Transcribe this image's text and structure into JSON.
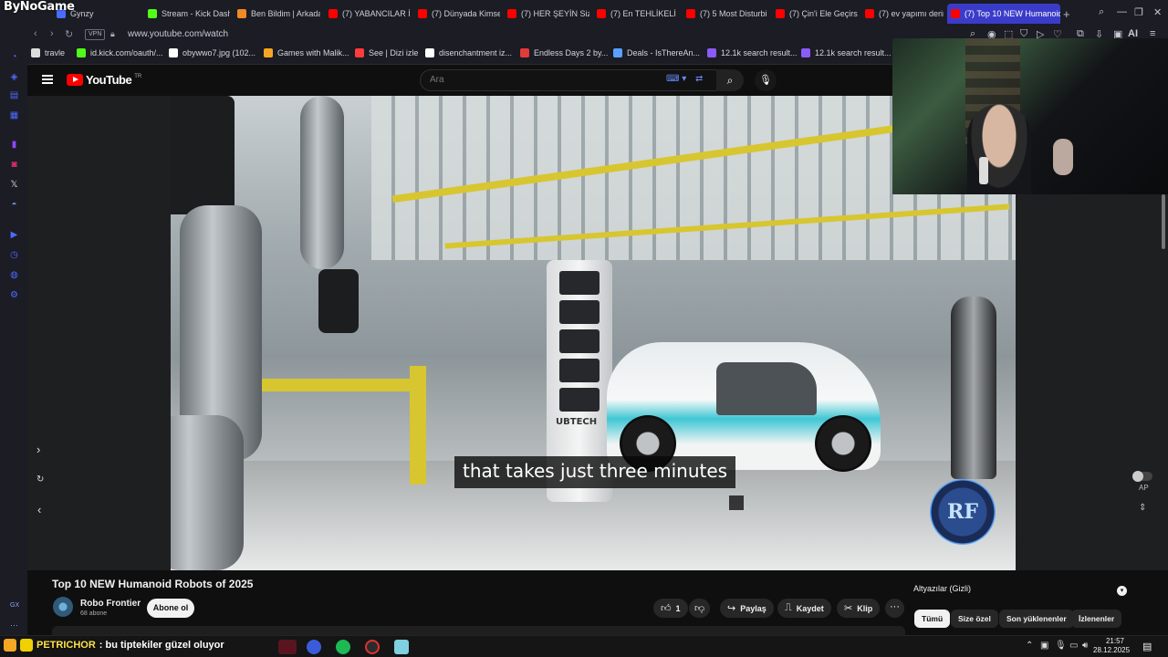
{
  "brand_logo": "ByNoGame",
  "tabs": [
    {
      "label": "Gynzy",
      "color": "#4a6cff"
    },
    {
      "label": "Stream - Kick Dash",
      "color": "#53fc18"
    },
    {
      "label": "Ben Bildim | Arkada",
      "color": "#f08a24"
    },
    {
      "label": "(7) YABANCILAR İ",
      "color": "#ff0000"
    },
    {
      "label": "(7) Dünyada Kimse",
      "color": "#ff0000"
    },
    {
      "label": "(7) HER ŞEYİN Siz",
      "color": "#ff0000"
    },
    {
      "label": "(7) En TEHLİKELİ",
      "color": "#ff0000"
    },
    {
      "label": "(7) 5 Most Disturbi",
      "color": "#ff0000"
    },
    {
      "label": "(7) Çin'i Ele Geçirs",
      "color": "#ff0000"
    },
    {
      "label": "(7) ev yapımı derin",
      "color": "#ff0000"
    },
    {
      "label": "(7) Top 10 NEW Humanoid",
      "color": "#ff0000",
      "active": true
    }
  ],
  "address": {
    "vpn": "VPN",
    "url": "www.youtube.com/watch",
    "ai_label": "AI"
  },
  "bookmarks": [
    {
      "label": "travle",
      "color": "#dddddd"
    },
    {
      "label": "id.kick.com/oauth/...",
      "color": "#53fc18"
    },
    {
      "label": "obywwo7.jpg (102...",
      "color": "#ffffff"
    },
    {
      "label": "Games with Malik...",
      "color": "#f5a623"
    },
    {
      "label": "See | Dizi izle",
      "color": "#ff3b3b"
    },
    {
      "label": "disenchantment iz...",
      "color": "#ffffff"
    },
    {
      "label": "Endless Days 2 by...",
      "color": "#e23b3b"
    },
    {
      "label": "Deals - IsThereAn...",
      "color": "#5aa0ff"
    },
    {
      "label": "12.1k search result...",
      "color": "#8a5cf5"
    },
    {
      "label": "12.1k search result...",
      "color": "#8a5cf5"
    }
  ],
  "sidebar": {
    "footer_label": "GX"
  },
  "youtube": {
    "logo_text": "YouTube",
    "logo_sup": "TR",
    "search_placeholder": "Ara"
  },
  "player": {
    "caption": "that takes just three minutes",
    "watermark": "RF",
    "brand_on_charger": "UBTECH",
    "ap_label": "AP"
  },
  "video": {
    "title": "Top 10 NEW Humanoid Robots of 2025",
    "channel": "Robo Frontier",
    "subscribers": "68 abone",
    "subscribe_label": "Abone ol",
    "like_count": "1",
    "share_label": "Paylaş",
    "save_label": "Kaydet",
    "clip_label": "Klip"
  },
  "right_panel": {
    "subtitles_label": "Altyazılar (Gizli)",
    "chips": [
      "Tümü",
      "Size özel",
      "Son yüklenenler",
      "İzlenenler"
    ]
  },
  "taskbar": {
    "chat_user": "PETRICHOR",
    "chat_message": ": bu tiptekiler güzel oluyor",
    "time": "21:57",
    "date": "28.12.2025"
  }
}
